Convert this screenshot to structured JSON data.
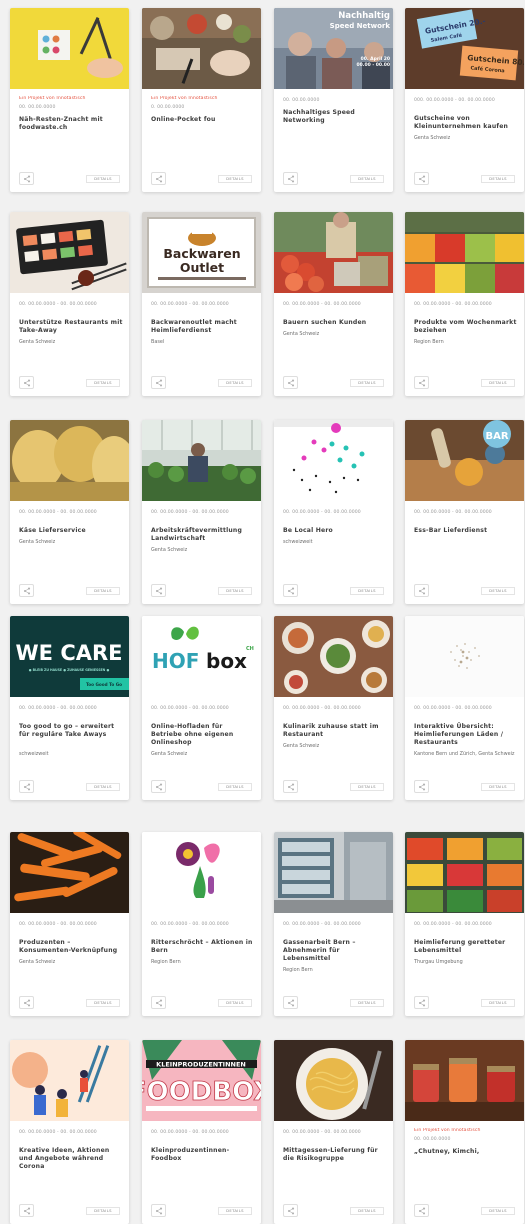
{
  "cards": [
    {
      "tag": "Ein Projekt von Innotastisch",
      "date": "00. 00.00.0000",
      "title": "Näh-Resten-Znacht mit foodwaste.ch",
      "org": "",
      "image": "foodwaste-table",
      "details": "DETAILS"
    },
    {
      "tag": "Ein Projekt von Innotastisch",
      "date": "0. 00.00.0000",
      "title": "Online-Pocket fou",
      "org": "",
      "image": "cooking-table",
      "details": "DETAILS"
    },
    {
      "tag": "",
      "date": "00. 00.00.0000",
      "title": "Nachhaltiges Speed Networking",
      "org": "",
      "image": "speed-networking",
      "details": "DETAILS"
    },
    {
      "tag": "",
      "date": "000. 00.00.0000 - 00. 00.00.0000",
      "title": "Gutscheine von Kleinunternehmen kaufen",
      "org": "Genta Schweiz",
      "image": "vouchers",
      "details": "DETAILS"
    },
    {
      "tag": "",
      "date": "00. 00.00.0000 - 00. 00.00.0000",
      "title": "Unterstütze Restaurants mit Take-Away",
      "org": "Genta Schweiz",
      "image": "sushi",
      "details": "DETAILS"
    },
    {
      "tag": "",
      "date": "00. 00.00.0000 - 00. 00.00.0000",
      "title": "Backwarenoutlet macht Heimlieferdienst",
      "org": "Basel",
      "image": "backwaren-outlet",
      "details": "DETAILS"
    },
    {
      "tag": "",
      "date": "00. 00.00.0000 - 00. 00.00.0000",
      "title": "Bauern suchen Kunden",
      "org": "Genta Schweiz",
      "image": "market-stall",
      "details": "DETAILS"
    },
    {
      "tag": "",
      "date": "00. 00.00.0000 - 00. 00.00.0000",
      "title": "Produkte vom Wochenmarkt beziehen",
      "org": "Region Bern",
      "image": "fruit-market",
      "details": "DETAILS"
    },
    {
      "tag": "",
      "date": "00. 00.00.0000 - 00. 00.00.0000",
      "title": "Käse Lieferservice",
      "org": "Genta Schweiz",
      "image": "cheese",
      "details": "DETAILS"
    },
    {
      "tag": "",
      "date": "00. 00.00.0000 - 00. 00.00.0000",
      "title": "Arbeitskräftevermittlung Landwirtschaft",
      "org": "Genta Schweiz",
      "image": "greenhouse",
      "details": "DETAILS"
    },
    {
      "tag": "",
      "date": "00. 00.00.0000 - 00. 00.00.0000",
      "title": "Be Local Hero",
      "org": "schweizweit",
      "image": "local-hero-map",
      "details": "DETAILS"
    },
    {
      "tag": "",
      "date": "00. 00.00.0000 - 00. 00.00.0000",
      "title": "Ess-Bar Lieferdienst",
      "org": "",
      "image": "ess-bar",
      "details": "DETAILS"
    },
    {
      "tag": "",
      "date": "00. 00.00.0000 - 00. 00.00.0000",
      "title": "Too good to go – erweitert für reguläre Take Aways",
      "org": "schweizweit",
      "image": "we-care",
      "details": "DETAILS"
    },
    {
      "tag": "",
      "date": "00. 00.00.0000 - 00. 00.00.0000",
      "title": "Online-Hofladen für Betriebe ohne eigenen Onlineshop",
      "org": "Genta Schweiz",
      "image": "hofbox",
      "details": "DETAILS"
    },
    {
      "tag": "",
      "date": "00. 00.00.0000 - 00. 00.00.0000",
      "title": "Kulinarik zuhause statt im Restaurant",
      "org": "Genta Schweiz",
      "image": "dining-table",
      "details": "DETAILS"
    },
    {
      "tag": "",
      "date": "00. 00.00.0000 - 00. 00.00.0000",
      "title": "Interaktive Übersicht: Heimlieferungen Läden / Restaurants",
      "org": "Kantone Bern und Zürich, Genta Schweiz",
      "image": "dot-map",
      "details": "DETAILS"
    },
    {
      "tag": "",
      "date": "00. 00.00.0000 - 00. 00.00.0000",
      "title": "Produzenten – Konsumenten-Verknüpfung",
      "org": "Genta Schweiz",
      "image": "carrots",
      "details": "DETAILS"
    },
    {
      "tag": "",
      "date": "00. 00.00.0000 - 00. 00.00.0000",
      "title": "Ritterschröcht – Aktionen in Bern",
      "org": "Region Bern",
      "image": "illustration",
      "details": "DETAILS"
    },
    {
      "tag": "",
      "date": "00. 00.00.0000 - 00. 00.00.0000",
      "title": "Gassenarbeit Bern – Abnehmerin für Lebensmittel",
      "org": "Region Bern",
      "image": "shelves",
      "details": "DETAILS"
    },
    {
      "tag": "",
      "date": "00. 00.00.0000 - 00. 00.00.0000",
      "title": "Heimlieferung geretteter Lebensmittel",
      "org": "Thurgau Umgebung",
      "image": "produce-crates",
      "details": "DETAILS"
    },
    {
      "tag": "",
      "date": "00. 00.00.0000 - 00. 00.00.0000",
      "title": "Kreative Ideen, Aktionen und Angebote während Corona",
      "org": "",
      "image": "people-illustration",
      "details": "DETAILS"
    },
    {
      "tag": "",
      "date": "00. 00.00.0000 - 00. 00.00.0000",
      "title": "Kleinproduzentinnen-Foodbox",
      "org": "",
      "image": "kleinproduzentinnen-foodbox",
      "details": "DETAILS"
    },
    {
      "tag": "",
      "date": "00. 00.00.0000 - 00. 00.00.0000",
      "title": "Mittagessen-Lieferung für die Risikogruppe",
      "org": "",
      "image": "spaghetti",
      "details": "DETAILS"
    },
    {
      "tag": "Ein Projekt von Innotastisch",
      "date": "00. 00.00.0000",
      "title": "„Chutney, Kimchi,",
      "org": "",
      "image": "jars",
      "details": "DETAILS"
    }
  ],
  "image_text": {
    "speed_networking": [
      "Nachhaltig",
      "Speed Network"
    ],
    "speed_networking_date": [
      "00. April 20",
      "00.00 - 00.00"
    ],
    "voucher_1": [
      "Gutschein 20.-",
      "Salem Café"
    ],
    "voucher_2": [
      "Gutschein 80.-",
      "Café Corona"
    ],
    "backwaren": [
      "Backwaren",
      "Outlet"
    ],
    "ess_bar": [
      "BAR"
    ],
    "we_care": [
      "WE CARE"
    ],
    "we_care_sub": "● BLEIB ZU HAUSE ● ZUHAUSE GENIESSEN ●",
    "we_care_badge": "Too Good To Go",
    "hofbox": [
      "HOF",
      "box",
      "CH"
    ],
    "foodbox": [
      "KLEINPRODUZENTINNEN",
      "FOODBOX"
    ]
  }
}
